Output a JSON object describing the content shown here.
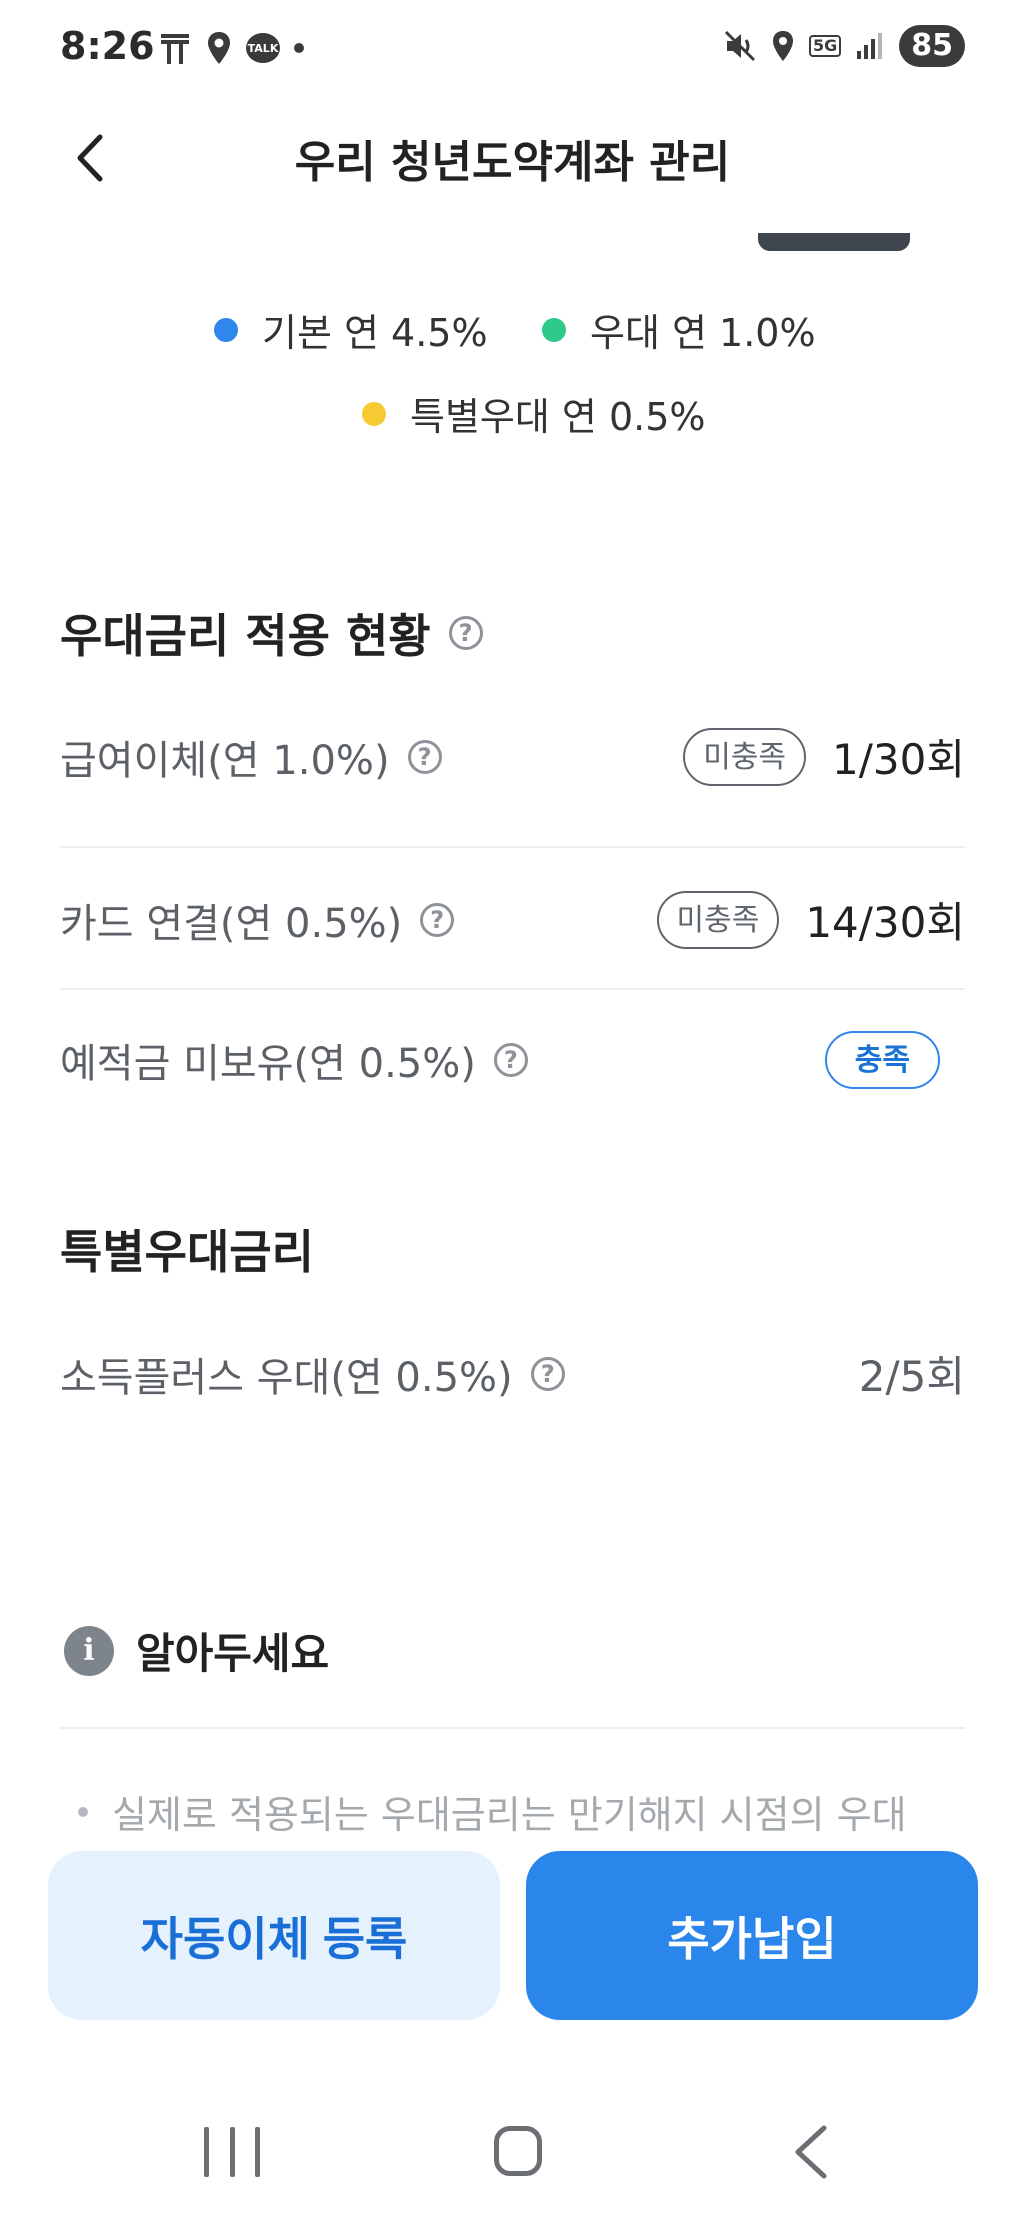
{
  "status_bar": {
    "time": "8:26",
    "talk_label": "TALK",
    "network": "5G",
    "battery": "85"
  },
  "header": {
    "title": "우리 청년도약계좌 관리",
    "back_icon": "chevron-left-icon"
  },
  "legend": [
    {
      "label": "기본 연 4.5%",
      "color": "#2f86eb"
    },
    {
      "label": "우대 연 1.0%",
      "color": "#2dc98a"
    },
    {
      "label": "특별우대 연 0.5%",
      "color": "#f7c933"
    }
  ],
  "preferential": {
    "title": "우대금리 적용 현황",
    "help_glyph": "?",
    "rows": [
      {
        "label": "급여이체(연 1.0%)",
        "status": "미충족",
        "count": "1/30회"
      },
      {
        "label": "카드 연결(연 0.5%)",
        "status": "미충족",
        "count": "14/30회"
      },
      {
        "label": "예적금 미보유(연 0.5%)",
        "status": "충족"
      }
    ]
  },
  "special": {
    "title": "특별우대금리",
    "rows": [
      {
        "label": "소득플러스 우대(연 0.5%)",
        "count": "2/5회"
      }
    ]
  },
  "notice": {
    "title": "알아두세요",
    "icon_glyph": "i",
    "items": [
      "실제로 적용되는 우대금리는 만기해지 시점의 우대"
    ]
  },
  "actions": {
    "auto_transfer": "자동이체 등록",
    "extra_payment": "추가납입"
  },
  "colors": {
    "primary": "#2a86ea",
    "primary_light": "#e5f1fc",
    "text_secondary": "#5c6168"
  }
}
